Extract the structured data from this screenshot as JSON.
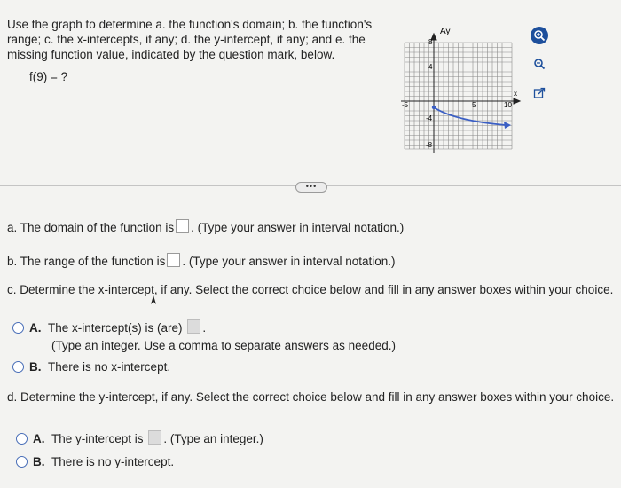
{
  "question": {
    "line1": "Use the graph to determine a. the function's domain; b. the function's",
    "line2": "range; c. the x-intercepts, if any; d. the y-intercept, if any; and e. the",
    "line3": "missing function value, indicated by the question mark, below.",
    "function_expr": "f(9) = ?"
  },
  "graph": {
    "y_label": "Ay",
    "x_label": "x",
    "y_top": "8",
    "y_mid_pos": "4",
    "y_mid_neg": "-4",
    "y_bottom": "-8",
    "x_left": "-5",
    "x_mid": "5",
    "x_right": "10"
  },
  "more_button": "•••",
  "part_a": {
    "prefix": "a. The domain of the function is",
    "suffix": ". (Type your answer in interval notation.)"
  },
  "part_b": {
    "prefix": "b. The range of the function is",
    "suffix": ". (Type your answer in interval notation.)"
  },
  "part_c": {
    "prompt": "c. Determine the x-intercept, if any. Select the correct choice below and fill in any answer boxes within your choice.",
    "option_a_letter": "A.",
    "option_a_text": "The x-intercept(s) is (are)",
    "option_a_suffix": ".",
    "option_a_hint": "(Type an integer. Use a comma to separate answers as needed.)",
    "option_b_letter": "B.",
    "option_b_text": "There is no x-intercept."
  },
  "part_d": {
    "prompt": "d. Determine the y-intercept, if any. Select the correct choice below and fill in any answer boxes within your choice.",
    "option_a_letter": "A.",
    "option_a_text": "The y-intercept is",
    "option_a_suffix": ". (Type an integer.)",
    "option_b_letter": "B.",
    "option_b_text": "There is no y-intercept."
  },
  "colors": {
    "curve": "#3b5fc4",
    "radio_border": "#4a6fb8",
    "icon_bg": "#1d4f9c"
  }
}
